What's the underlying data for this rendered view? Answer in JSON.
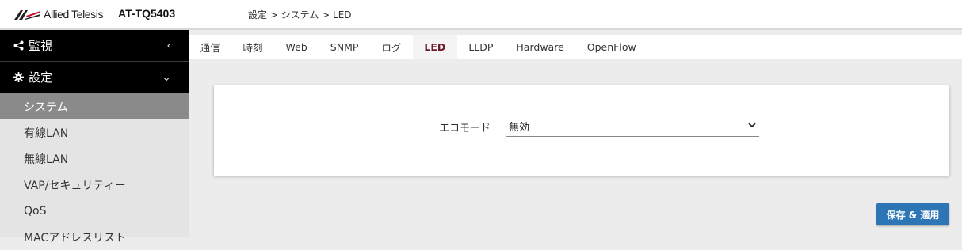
{
  "header": {
    "logo_text": "Allied Telesis",
    "model": "AT-TQ5403",
    "breadcrumb": "設定 > システム > LED"
  },
  "sidebar": {
    "sections": [
      {
        "label": "監視",
        "icon": "share-icon",
        "state": "collapsed"
      },
      {
        "label": "設定",
        "icon": "gear-icon",
        "state": "expanded"
      }
    ],
    "items": [
      {
        "label": "システム",
        "active": true
      },
      {
        "label": "有線LAN"
      },
      {
        "label": "無線LAN"
      },
      {
        "label": "VAP/セキュリティー"
      },
      {
        "label": "QoS"
      },
      {
        "label": "MACアドレスリスト"
      }
    ]
  },
  "tabs": [
    {
      "label": "通信"
    },
    {
      "label": "時刻"
    },
    {
      "label": "Web"
    },
    {
      "label": "SNMP"
    },
    {
      "label": "ログ"
    },
    {
      "label": "LED",
      "active": true
    },
    {
      "label": "LLDP"
    },
    {
      "label": "Hardware"
    },
    {
      "label": "OpenFlow"
    }
  ],
  "form": {
    "eco_mode_label": "エコモード",
    "eco_mode_value": "無効"
  },
  "actions": {
    "apply_label": "保存 & 適用"
  },
  "colors": {
    "accent": "#2e75b6",
    "active_tab_text": "#6a1a2a",
    "sidebar_header_bg": "#000000",
    "sidebar_active_bg": "#8a8a8a"
  }
}
